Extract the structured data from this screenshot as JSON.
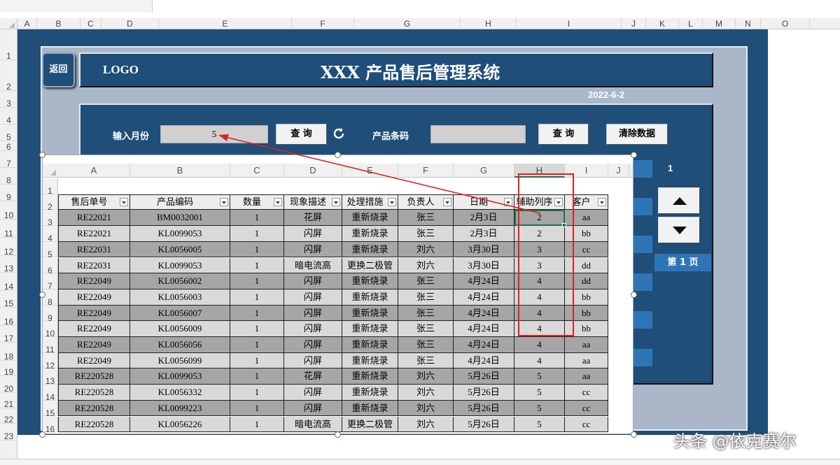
{
  "outer": {
    "columns": [
      "A",
      "B",
      "C",
      "D",
      "E",
      "F",
      "G",
      "H",
      "I",
      "J",
      "K",
      "L",
      "M",
      "N",
      "O"
    ],
    "rows": [
      "1",
      "2",
      "3",
      "4",
      "5",
      "6",
      "7",
      "8",
      "9",
      "10",
      "11",
      "12",
      "13",
      "14",
      "15",
      "16",
      "17",
      "18",
      "19",
      "20",
      "21",
      "22",
      "23"
    ]
  },
  "header": {
    "back_label": "返回",
    "logo": "LOGO",
    "title": "XXX 产品售后管理系统",
    "date": "2022-6-2"
  },
  "query": {
    "month_label": "输入月份",
    "month_value": "5",
    "query_button": "查 询",
    "barcode_label": "产品条码",
    "barcode_value": "",
    "query_button_2": "查 询",
    "clear_button": "清除数据"
  },
  "pager": {
    "current": "1",
    "page_label": "第 1 页"
  },
  "table": {
    "col_letters": [
      "A",
      "B",
      "C",
      "D",
      "E",
      "F",
      "G",
      "H",
      "I",
      "J"
    ],
    "row_numbers": [
      "1",
      "2",
      "3",
      "4",
      "5",
      "6",
      "7",
      "8",
      "9",
      "10",
      "11",
      "12",
      "13",
      "14",
      "15",
      "16"
    ],
    "headers": [
      "售后单号",
      "产品编码",
      "数量",
      "现象描述",
      "处理措施",
      "负责人",
      "日期",
      "辅助列序",
      "客户"
    ],
    "rows": [
      [
        "RE22021",
        "BM0032001",
        "1",
        "花屏",
        "重新烧录",
        "张三",
        "2月3日",
        "2",
        "aa"
      ],
      [
        "RE22021",
        "KL0099053",
        "1",
        "闪屏",
        "重新烧录",
        "张三",
        "2月3日",
        "2",
        "bb"
      ],
      [
        "RE22031",
        "KL0056005",
        "1",
        "闪屏",
        "重新烧录",
        "刘六",
        "3月30日",
        "3",
        "cc"
      ],
      [
        "RE22031",
        "KL0099053",
        "1",
        "暗电流高",
        "更换二极管",
        "刘六",
        "3月30日",
        "3",
        "dd"
      ],
      [
        "RE22049",
        "KL0056002",
        "1",
        "闪屏",
        "重新烧录",
        "张三",
        "4月24日",
        "4",
        "dd"
      ],
      [
        "RE22049",
        "KL0056003",
        "1",
        "闪屏",
        "重新烧录",
        "张三",
        "4月24日",
        "4",
        "bb"
      ],
      [
        "RE22049",
        "KL0056007",
        "1",
        "闪屏",
        "重新烧录",
        "张三",
        "4月24日",
        "4",
        "bb"
      ],
      [
        "RE22049",
        "KL0056009",
        "1",
        "闪屏",
        "重新烧录",
        "张三",
        "4月24日",
        "4",
        "bb"
      ],
      [
        "RE22049",
        "KL0056056",
        "1",
        "闪屏",
        "重新烧录",
        "张三",
        "4月24日",
        "4",
        "aa"
      ],
      [
        "RE22049",
        "KL0056099",
        "1",
        "闪屏",
        "重新烧录",
        "张三",
        "4月24日",
        "4",
        "aa"
      ],
      [
        "RE220528",
        "KL0099053",
        "1",
        "花屏",
        "重新烧录",
        "刘六",
        "5月26日",
        "5",
        "aa"
      ],
      [
        "RE220528",
        "KL0056332",
        "1",
        "闪屏",
        "重新烧录",
        "刘六",
        "5月26日",
        "5",
        "cc"
      ],
      [
        "RE220528",
        "KL0099223",
        "1",
        "闪屏",
        "重新烧录",
        "刘六",
        "5月26日",
        "5",
        "cc"
      ],
      [
        "RE220528",
        "KL0056226",
        "1",
        "暗电流高",
        "更换二极管",
        "刘六",
        "5月26日",
        "5",
        "cc"
      ]
    ]
  },
  "colors": {
    "panel": "#1f4e79",
    "accent": "#2e75b6",
    "annotation": "#e02020",
    "row_dark": "#a6a6a6",
    "row_light": "#d9d9d9"
  },
  "watermark": "头条 @依克赛尔"
}
